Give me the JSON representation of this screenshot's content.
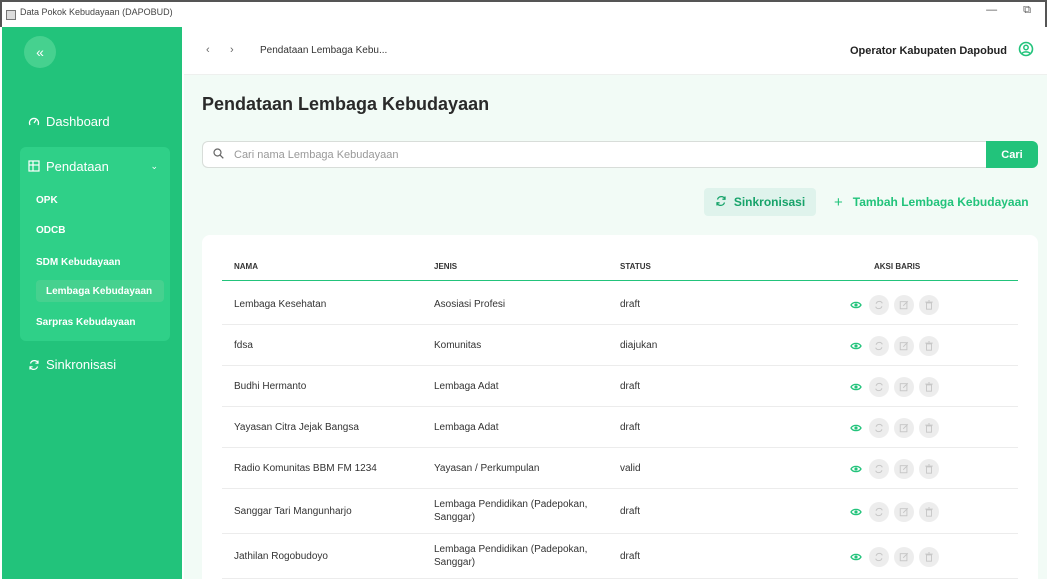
{
  "window": {
    "title": "Data Pokok Kebudayaan (DAPOBUD)",
    "minimize": "—",
    "restore": "⧉"
  },
  "sidebar": {
    "collapse_icon": "«",
    "dashboard": "Dashboard",
    "pendataan": "Pendataan",
    "sub_items": [
      "OPK",
      "ODCB",
      "SDM Kebudayaan",
      "Lembaga Kebudayaan",
      "Sarpras Kebudayaan"
    ],
    "active_item": "Lembaga Kebudayaan",
    "sinkronisasi": "Sinkronisasi"
  },
  "header": {
    "breadcrumb": "Pendataan Lembaga Kebu...",
    "user": "Operator Kabupaten Dapobud"
  },
  "main": {
    "title": "Pendataan Lembaga Kebudayaan",
    "search_placeholder": "Cari nama Lembaga Kebudayaan",
    "search_button": "Cari",
    "sync_button": "Sinkronisasi",
    "add_button": "Tambah Lembaga Kebudayaan"
  },
  "table": {
    "columns": [
      "NAMA",
      "JENIS",
      "STATUS",
      "AKSI BARIS"
    ],
    "rows": [
      {
        "nama": "Lembaga Kesehatan",
        "jenis": "Asosiasi Profesi",
        "status": "draft"
      },
      {
        "nama": "fdsa",
        "jenis": "Komunitas",
        "status": "diajukan"
      },
      {
        "nama": "Budhi Hermanto",
        "jenis": "Lembaga Adat",
        "status": "draft"
      },
      {
        "nama": "Yayasan Citra Jejak Bangsa",
        "jenis": "Lembaga Adat",
        "status": "draft"
      },
      {
        "nama": "Radio Komunitas BBM FM 1234",
        "jenis": "Yayasan / Perkumpulan",
        "status": "valid"
      },
      {
        "nama": "Sanggar Tari Mangunharjo",
        "jenis": "Lembaga Pendidikan (Padepokan, Sanggar)",
        "status": "draft"
      },
      {
        "nama": "Jathilan Rogobudoyo",
        "jenis": "Lembaga Pendidikan (Padepokan, Sanggar)",
        "status": "draft"
      }
    ]
  },
  "colors": {
    "primary": "#22c37b",
    "sidebar_group": "#2fd088",
    "active": "#46d18f",
    "page_bg": "#f2fbf6"
  }
}
